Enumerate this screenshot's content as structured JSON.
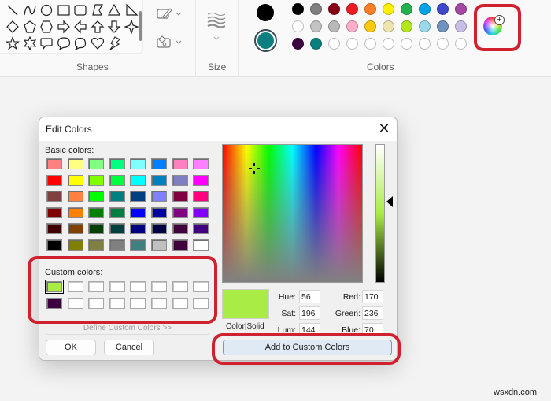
{
  "ribbon": {
    "groups": {
      "shapes": "Shapes",
      "size": "Size",
      "colors": "Colors"
    },
    "shapes": [
      {
        "name": "line",
        "icon": "line-icon"
      },
      {
        "name": "curve",
        "icon": "curve-icon"
      },
      {
        "name": "oval",
        "icon": "oval-icon"
      },
      {
        "name": "rectangle",
        "icon": "rectangle-icon"
      },
      {
        "name": "rounded-rectangle",
        "icon": "rounded-rectangle-icon"
      },
      {
        "name": "polygon",
        "icon": "polygon-icon"
      },
      {
        "name": "triangle",
        "icon": "triangle-icon"
      },
      {
        "name": "right-triangle",
        "icon": "right-triangle-icon"
      },
      {
        "name": "diamond",
        "icon": "diamond-icon"
      },
      {
        "name": "pentagon",
        "icon": "pentagon-icon"
      },
      {
        "name": "hexagon",
        "icon": "hexagon-icon"
      },
      {
        "name": "right-arrow",
        "icon": "right-arrow-icon"
      },
      {
        "name": "left-arrow",
        "icon": "left-arrow-icon"
      },
      {
        "name": "up-arrow",
        "icon": "up-arrow-icon"
      },
      {
        "name": "down-arrow",
        "icon": "down-arrow-icon"
      },
      {
        "name": "four-point-star",
        "icon": "four-point-star-icon"
      },
      {
        "name": "five-point-star",
        "icon": "five-point-star-icon"
      },
      {
        "name": "six-point-star",
        "icon": "six-point-star-icon"
      },
      {
        "name": "rounded-callout",
        "icon": "rounded-callout-icon"
      },
      {
        "name": "oval-callout",
        "icon": "oval-callout-icon"
      },
      {
        "name": "cloud-callout",
        "icon": "cloud-callout-icon"
      },
      {
        "name": "heart",
        "icon": "heart-icon"
      },
      {
        "name": "lightning",
        "icon": "lightning-icon"
      }
    ],
    "outline_icon": "outline-icon",
    "fill_icon": "fill-icon",
    "size_icon": "brush-size-icon",
    "color1": "#000000",
    "color2": "#0b7f7f",
    "palette": [
      [
        "#000000",
        "#7f7f7f",
        "#880015",
        "#ed1c24",
        "#ff7f27",
        "#fff200",
        "#22b14c",
        "#00a2e8",
        "#3f48cc",
        "#a349a4"
      ],
      [
        "#ffffff",
        "#c3c3c3",
        "#b9b9b9",
        "#ffaec9",
        "#ffc90e",
        "#efe4b0",
        "#b5e61d",
        "#99d9ea",
        "#7092be",
        "#c8bfe7"
      ],
      [
        "#3c0040",
        "#0b7f7f",
        "",
        "",
        "",
        "",
        "",
        "",
        "",
        ""
      ]
    ],
    "edit_colors_icon": "color-wheel-plus-icon"
  },
  "dialog": {
    "title": "Edit Colors",
    "close_icon": "close-icon",
    "basic_colors_label": "Basic colors:",
    "basic_colors": [
      [
        "#ff8080",
        "#ffff80",
        "#80ff80",
        "#00ff80",
        "#80ffff",
        "#0080ff",
        "#ff80c0",
        "#ff80ff"
      ],
      [
        "#ff0000",
        "#ffff00",
        "#80ff00",
        "#00ff40",
        "#00ffff",
        "#0080c0",
        "#8080c0",
        "#ff00ff"
      ],
      [
        "#804040",
        "#ff8040",
        "#00ff00",
        "#008080",
        "#004080",
        "#8080ff",
        "#800040",
        "#ff0080"
      ],
      [
        "#800000",
        "#ff8000",
        "#008000",
        "#008040",
        "#0000ff",
        "#0000a0",
        "#800080",
        "#8000ff"
      ],
      [
        "#400000",
        "#804000",
        "#004000",
        "#004040",
        "#000080",
        "#000040",
        "#400040",
        "#400080"
      ],
      [
        "#000000",
        "#808000",
        "#808040",
        "#808080",
        "#408080",
        "#c0c0c0",
        "#400040",
        "#ffffff"
      ]
    ],
    "custom_colors_label": "Custom colors:",
    "custom_colors": [
      [
        "#aaec46",
        "",
        "",
        "",
        "",
        "",
        "",
        ""
      ],
      [
        "#3c0040",
        "",
        "",
        "",
        "",
        "",
        "",
        ""
      ]
    ],
    "define_custom_label": "Define Custom Colors >>",
    "ok_label": "OK",
    "cancel_label": "Cancel",
    "preview_label": "Color|Solid",
    "preview_color": "#aaec46",
    "fields": {
      "hue": {
        "label": "Hue:",
        "value": "56"
      },
      "sat": {
        "label": "Sat:",
        "value": "196"
      },
      "lum": {
        "label": "Lum:",
        "value": "144"
      },
      "red": {
        "label": "Red:",
        "value": "170"
      },
      "green": {
        "label": "Green:",
        "value": "236"
      },
      "blue": {
        "label": "Blue:",
        "value": "70"
      }
    },
    "add_custom_label": "Add to Custom Colors"
  },
  "annotation_color": "#d0212f",
  "watermark": "wsxdn.com"
}
